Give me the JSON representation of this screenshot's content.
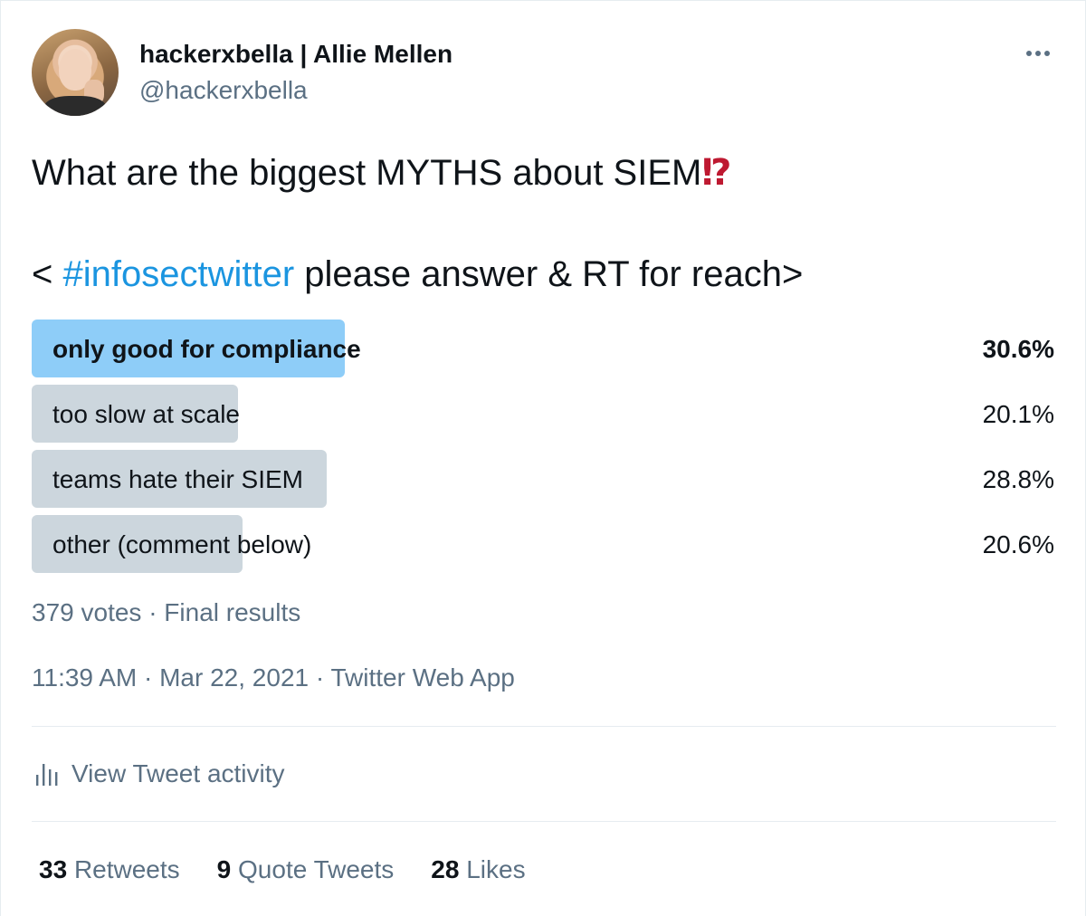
{
  "author": {
    "display_name": "hackerxbella | Allie Mellen",
    "handle": "@hackerxbella"
  },
  "tweet": {
    "line1": "What are the biggest MYTHS about SIEM",
    "emoji": "⁉",
    "line2_prefix": "< ",
    "hashtag": "#infosectwitter",
    "line2_suffix": " please answer & RT for reach>"
  },
  "poll": {
    "options": [
      {
        "label": "only good for compliance",
        "percent_text": "30.6%",
        "percent": 30.6,
        "winner": true
      },
      {
        "label": "too slow at scale",
        "percent_text": "20.1%",
        "percent": 20.1,
        "winner": false
      },
      {
        "label": "teams hate their SIEM",
        "percent_text": "28.8%",
        "percent": 28.8,
        "winner": false
      },
      {
        "label": "other (comment below)",
        "percent_text": "20.6%",
        "percent": 20.6,
        "winner": false
      }
    ],
    "meta": "379 votes · Final results"
  },
  "timestamp": "11:39 AM · Mar 22, 2021 · Twitter Web App",
  "activity_label": "View Tweet activity",
  "stats": {
    "retweets_count": "33",
    "retweets_label": "Retweets",
    "quotes_count": "9",
    "quotes_label": "Quote Tweets",
    "likes_count": "28",
    "likes_label": "Likes"
  },
  "colors": {
    "winner_bar": "#8ecdf8",
    "other_bar": "#ccd6dd",
    "hashtag": "#1b95e0",
    "secondary_text": "#5b7083"
  },
  "icons": {
    "more": "more-horizontal-icon",
    "activity": "bar-chart-icon",
    "emoji": "exclamation-question-mark-emoji"
  }
}
